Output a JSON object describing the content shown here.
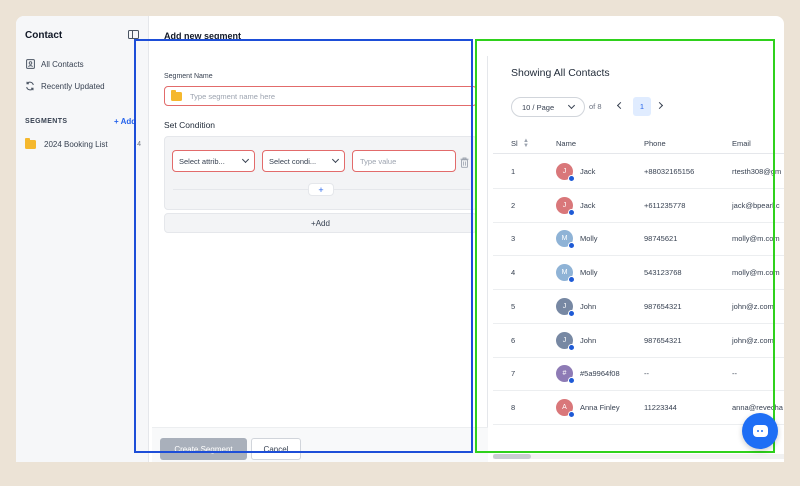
{
  "sidebar": {
    "title": "Contact",
    "items": [
      {
        "label": "All Contacts",
        "icon": "contact-book-icon"
      },
      {
        "label": "Recently Updated",
        "icon": "refresh-icon"
      }
    ],
    "segments_heading": "SEGMENTS",
    "add_label": "+ Add",
    "segment_lists": [
      {
        "label": "2024 Booking List",
        "count": "4"
      }
    ]
  },
  "header": {
    "title": "Add new segment"
  },
  "form": {
    "segment_name_label": "Segment Name",
    "segment_name_placeholder": "Type segment name here",
    "set_condition_label": "Set Condition",
    "attribute_select": "Select attrib...",
    "condition_select": "Select condi...",
    "value_placeholder": "Type value",
    "add_condition_plus": "+",
    "add_label": "+Add",
    "create_button": "Create Segment",
    "cancel_button": "Cancel"
  },
  "contacts": {
    "title": "Showing All Contacts",
    "per_page": "10 / Page",
    "of_pages": "of 8",
    "current_page": "1",
    "columns": [
      "Sl",
      "Name",
      "Phone",
      "Email"
    ],
    "rows": [
      {
        "sl": "1",
        "initial": "J",
        "name": "Jack",
        "phone": "+88032165156",
        "email": "rtesth308@gm",
        "color": "#d9777a"
      },
      {
        "sl": "2",
        "initial": "J",
        "name": "Jack",
        "phone": "+611235778",
        "email": "jack@bpearl.c",
        "color": "#d9777a"
      },
      {
        "sl": "3",
        "initial": "M",
        "name": "Molly",
        "phone": "98745621",
        "email": "molly@m.com",
        "color": "#8fb3d6"
      },
      {
        "sl": "4",
        "initial": "M",
        "name": "Molly",
        "phone": "543123768",
        "email": "molly@m.com",
        "color": "#8fb3d6"
      },
      {
        "sl": "5",
        "initial": "J",
        "name": "John",
        "phone": "987654321",
        "email": "john@z.com",
        "color": "#7788a3"
      },
      {
        "sl": "6",
        "initial": "J",
        "name": "John",
        "phone": "987654321",
        "email": "john@z.com",
        "color": "#7788a3"
      },
      {
        "sl": "7",
        "initial": "#",
        "name": "#5a9964f08",
        "phone": "--",
        "email": "--",
        "color": "#8e7bb5"
      },
      {
        "sl": "8",
        "initial": "A",
        "name": "Anna Finley",
        "phone": "11223344",
        "email": "anna@revecha",
        "color": "#d9777a"
      }
    ]
  }
}
